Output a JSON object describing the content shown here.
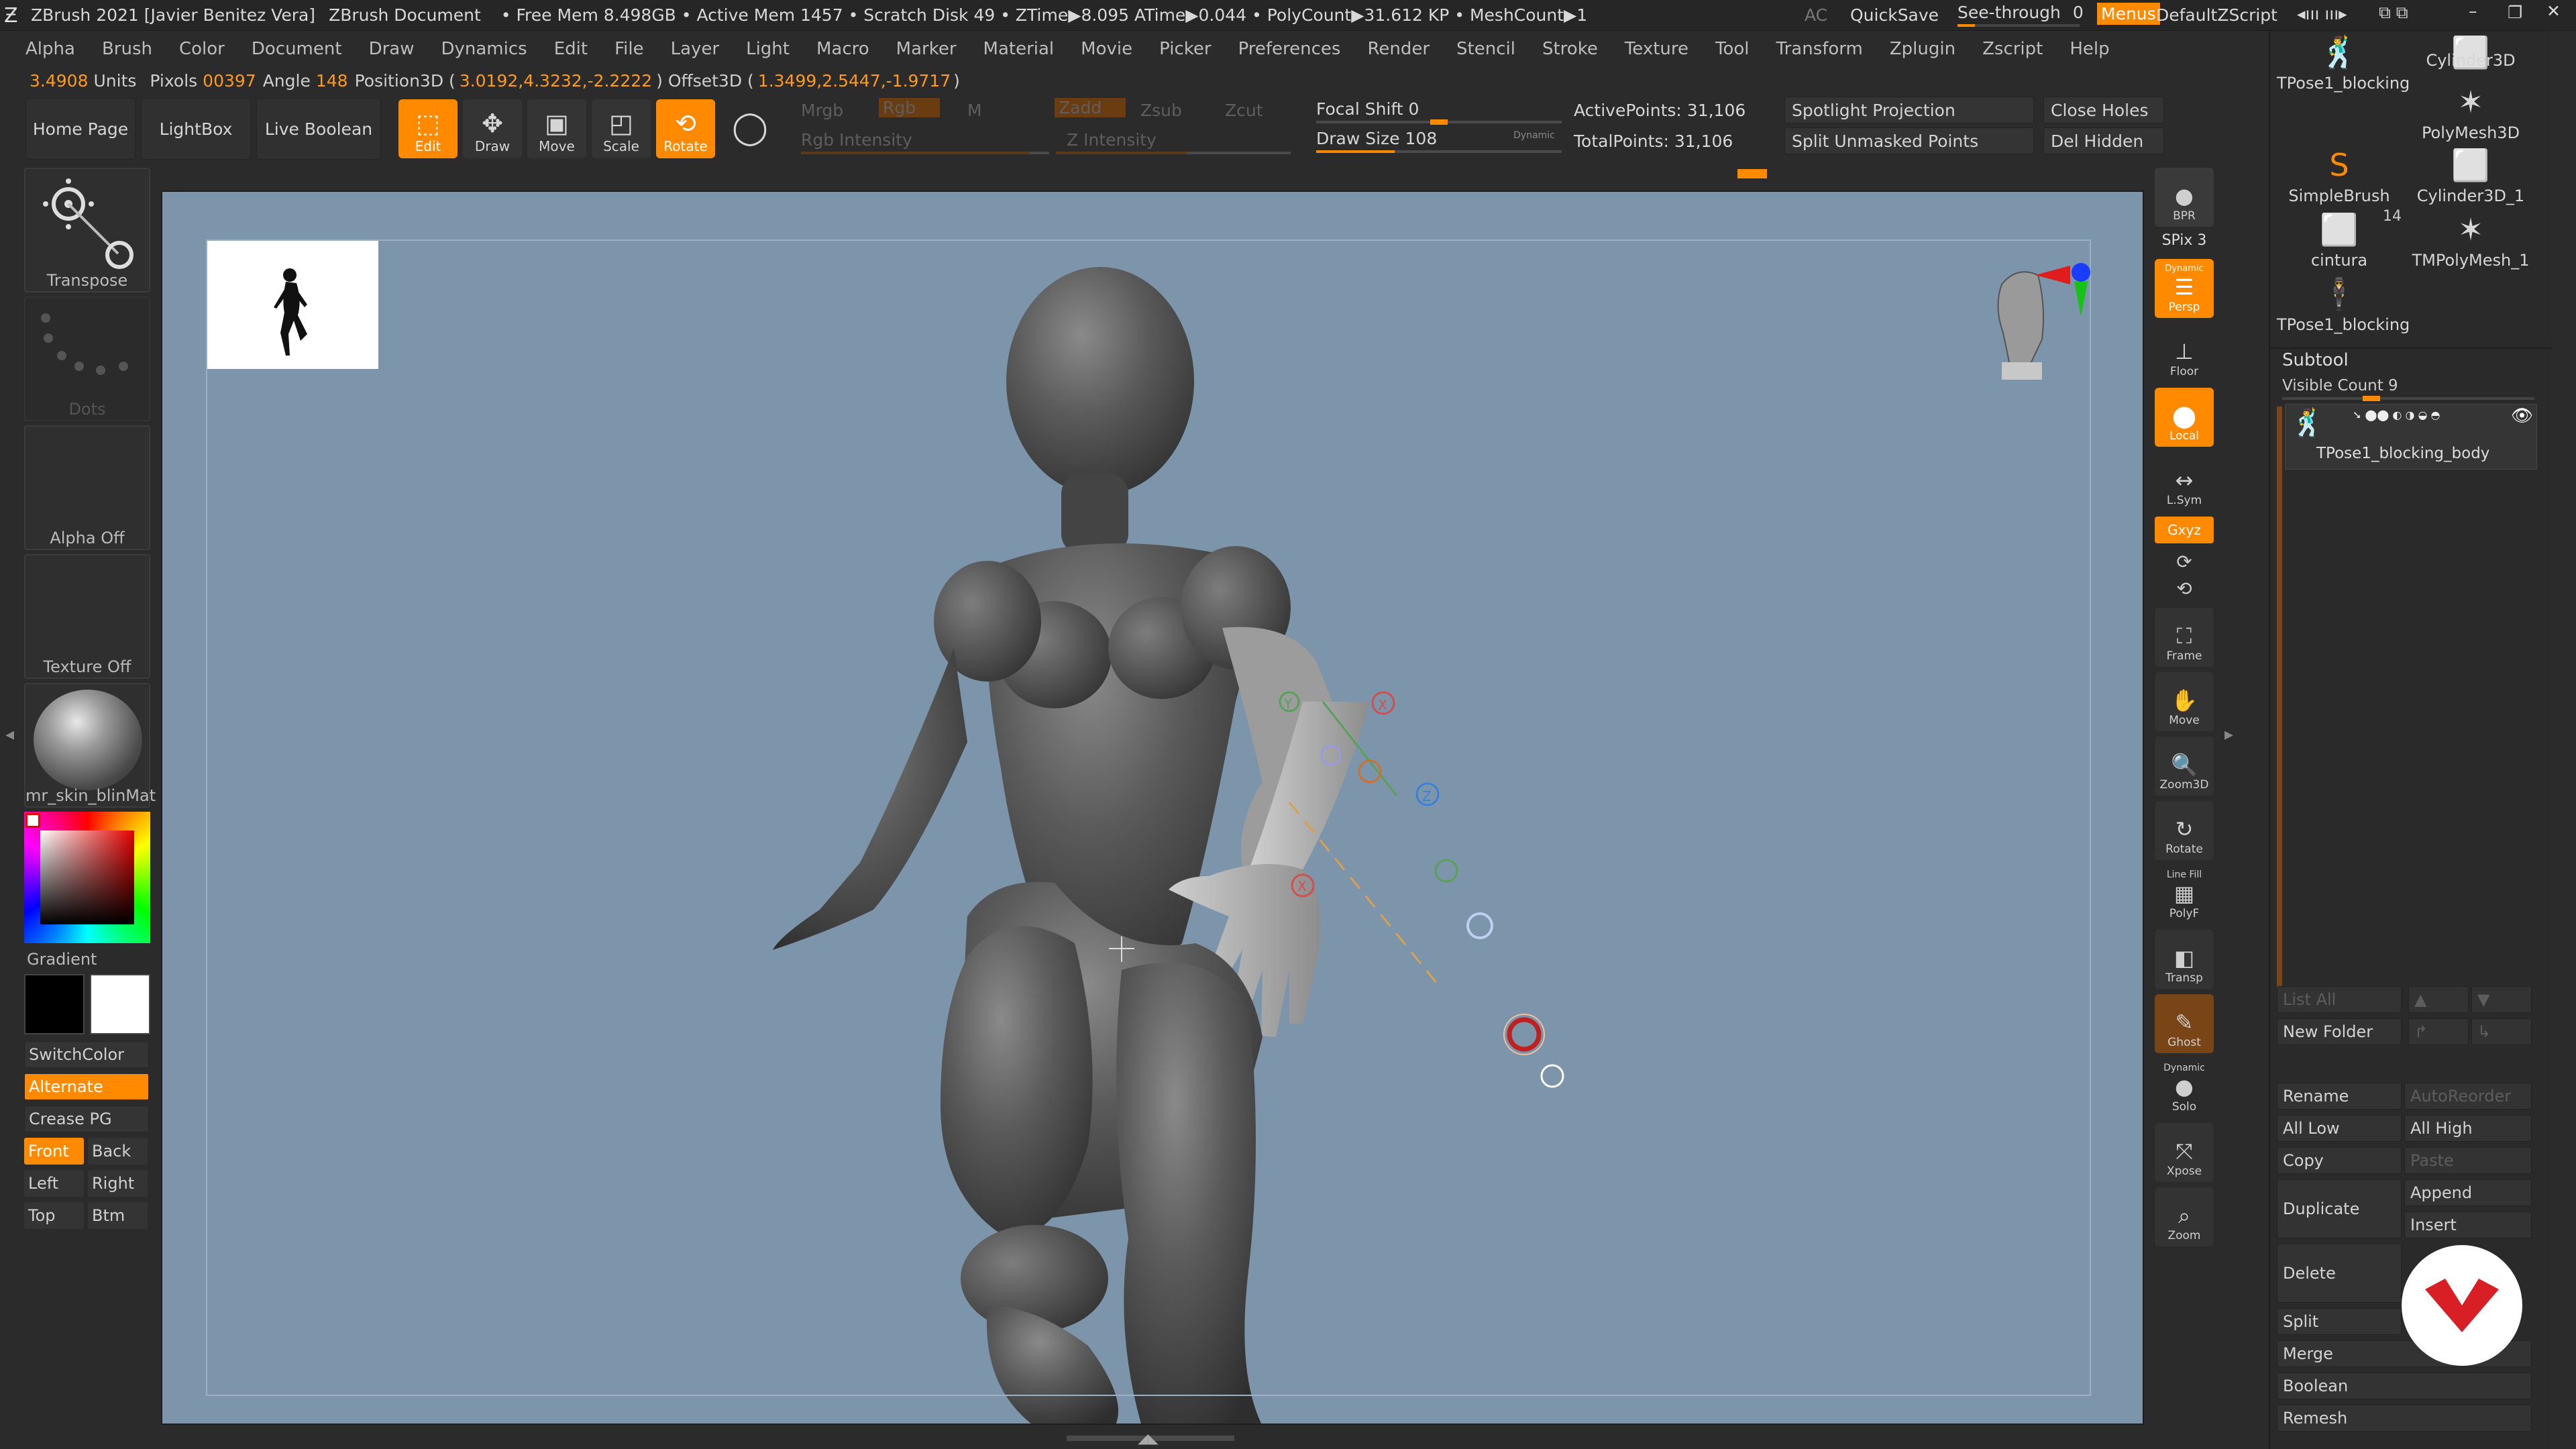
{
  "titlebar": {
    "title": "ZBrush 2021 [Javier Benitez Vera]",
    "document": "ZBrush Document",
    "stats": "• Free Mem 8.498GB • Active Mem 1457 • Scratch Disk 49 • ZTime▶8.095 ATime▶0.044 • PolyCount▶31.612 KP • MeshCount▶1",
    "ac": "AC",
    "quicksave": "QuickSave",
    "see_through": "See-through",
    "see_through_value": "0",
    "menus_label": "Menus",
    "script_label": "DefaultZScript"
  },
  "menubar": [
    "Alpha",
    "Brush",
    "Color",
    "Document",
    "Draw",
    "Dynamics",
    "Edit",
    "File",
    "Layer",
    "Light",
    "Macro",
    "Marker",
    "Material",
    "Movie",
    "Picker",
    "Preferences",
    "Render",
    "Stencil",
    "Stroke",
    "Texture",
    "Tool",
    "Transform",
    "Zplugin",
    "Zscript",
    "Help"
  ],
  "infobar": {
    "units_value": "3.4908",
    "units_label": "Units",
    "pixols_label": "Pixols",
    "pixols_value": "00397",
    "angle_label": "Angle",
    "angle_value": "148",
    "pos_label": "Position3D (",
    "pos_value": "3.0192,4.3232,-2.2222",
    "offset_label": ") Offset3D (",
    "offset_value": "1.3499,2.5447,-1.9717",
    "close": ")"
  },
  "shelf": {
    "home": "Home Page",
    "lightbox": "LightBox",
    "liveboolean": "Live Boolean",
    "edit": "Edit",
    "draw": "Draw",
    "move": "Move",
    "scale": "Scale",
    "rotate": "Rotate",
    "mrgb": "Mrgb",
    "rgb": "Rgb",
    "m": "M",
    "rgb_intensity": "Rgb Intensity",
    "zadd": "Zadd",
    "zsub": "Zsub",
    "zcut": "Zcut",
    "z_intensity": "Z Intensity",
    "focal_shift": "Focal Shift 0",
    "focal_fill": 0.0,
    "draw_size": "Draw Size 108",
    "draw_size_fill": 0.32,
    "dynamic": "Dynamic",
    "active_points": "ActivePoints: 31,106",
    "total_points": "TotalPoints: 31,106",
    "spotlight": "Spotlight Projection",
    "split_unmasked": "Split Unmasked Points",
    "close_holes": "Close Holes",
    "del_hidden": "Del Hidden"
  },
  "leftpanel": {
    "transpose": "Transpose",
    "dots": "Dots",
    "alpha": "Alpha Off",
    "texture": "Texture Off",
    "material": "mr_skin_blinMat",
    "gradient": "Gradient",
    "switchcolor": "SwitchColor",
    "alternate": "Alternate",
    "creasepg": "Crease PG",
    "front": "Front",
    "back": "Back",
    "left": "Left",
    "right": "Right",
    "top": "Top",
    "btm": "Btm"
  },
  "righttools": {
    "bpr": "BPR",
    "spix": "SPix 3",
    "persp": "Persp",
    "persp_top": "Dynamic",
    "floor": "Floor",
    "local": "Local",
    "lsym": "L.Sym",
    "xyz": "Gxyz",
    "frame": "Frame",
    "move": "Move",
    "zoom3d": "Zoom3D",
    "rotate": "Rotate",
    "linefill": "Line Fill",
    "polyf": "PolyF",
    "transp": "Transp",
    "ghost": "Ghost",
    "dynamic": "Dynamic",
    "solo": "Solo",
    "xpose": "Xpose",
    "zoom": "Zoom"
  },
  "toolpanel": {
    "items": [
      {
        "name": "TPose1_blocking"
      },
      {
        "name": "Cylinder3D"
      },
      {
        "name": "PolyMesh3D"
      },
      {
        "name": "SimpleBrush"
      },
      {
        "name": "Cylinder3D_1"
      },
      {
        "name": "cintura"
      },
      {
        "name": "TMPolyMesh_1"
      },
      {
        "name": "TPose1_blocking"
      }
    ],
    "count_badge": "14"
  },
  "subtool": {
    "header": "Subtool",
    "visible_count": "Visible Count 9",
    "item_name": "TPose1_blocking_body",
    "list_all": "List All",
    "new_folder": "New Folder",
    "rename": "Rename",
    "autoreorder": "AutoReorder",
    "all_low": "All Low",
    "all_high": "All High",
    "copy": "Copy",
    "paste": "Paste",
    "duplicate": "Duplicate",
    "append": "Append",
    "insert": "Insert",
    "delete": "Delete",
    "split": "Split",
    "merge": "Merge",
    "boolean": "Boolean",
    "remesh": "Remesh"
  },
  "gizmo_labels": {
    "x": "X",
    "y": "Y",
    "z": "Z"
  },
  "colors": {
    "accent": "#ff8a00",
    "canvas": "#7c95ab",
    "panel": "#2b2b2b"
  }
}
